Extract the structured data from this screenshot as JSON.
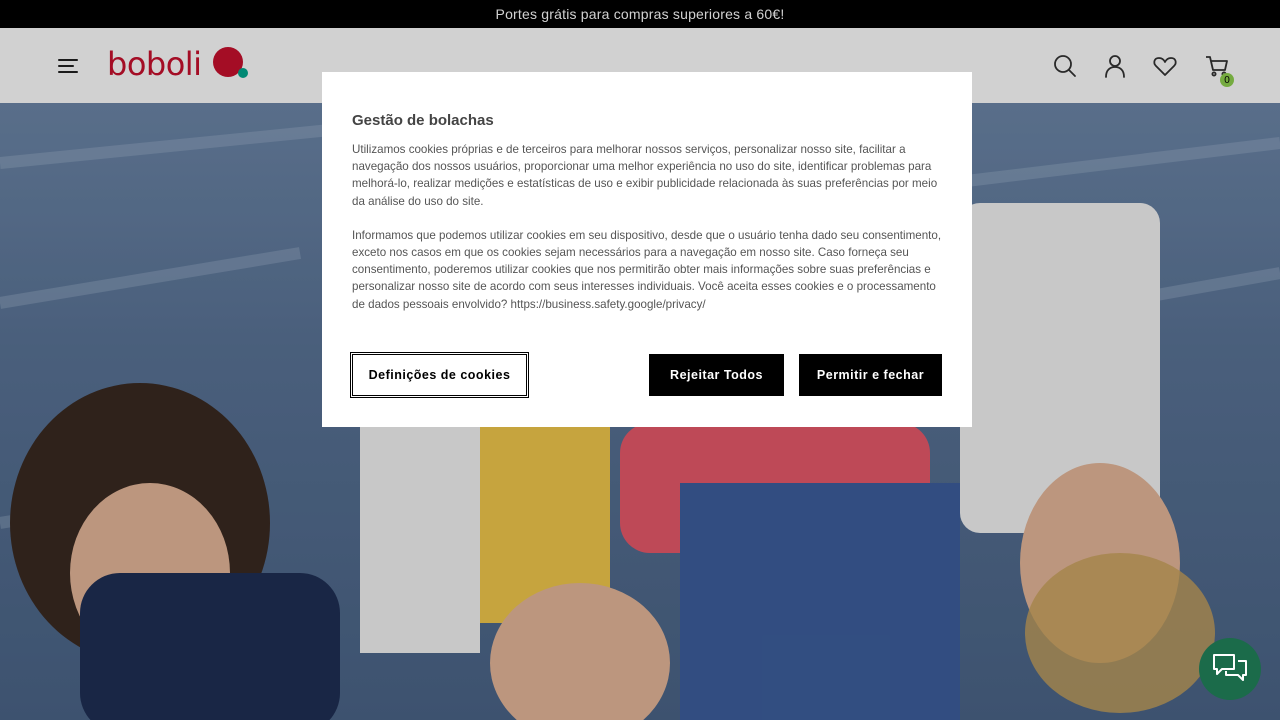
{
  "topbar": {
    "text": "Portes grátis para compras superiores a 60€!"
  },
  "header": {
    "logo_text": "boboli",
    "cart_count": "0",
    "icons": [
      "menu-icon",
      "search-icon",
      "user-icon",
      "heart-icon",
      "cart-icon"
    ]
  },
  "cookie_modal": {
    "title": "Gestão de bolachas",
    "paragraph1": "Utilizamos cookies próprias e de terceiros para melhorar nossos serviços, personalizar nosso site, facilitar a navegação dos nossos usuários, proporcionar uma melhor experiência no uso do site, identificar problemas para melhorá-lo, realizar medições e estatísticas de uso e exibir publicidade relacionada às suas preferências por meio da análise do uso do site.",
    "paragraph2": "Informamos que podemos utilizar cookies em seu dispositivo, desde que o usuário tenha dado seu consentimento, exceto nos casos em que os cookies sejam necessários para a navegação em nosso site. Caso forneça seu consentimento, poderemos utilizar cookies que nos permitirão obter mais informações sobre suas preferências e personalizar nosso site de acordo com seus interesses individuais. Você aceita esses cookies e o processamento de dados pessoais envolvido? https://business.safety.google/privacy/",
    "settings_label": "Definições de cookies",
    "reject_label": "Rejeitar Todos",
    "accept_label": "Permitir e fechar"
  },
  "colors": {
    "brand_red": "#c8102e",
    "brand_green": "#00a88e",
    "cart_badge": "#8fd14f",
    "chat": "#1b6b4a"
  }
}
